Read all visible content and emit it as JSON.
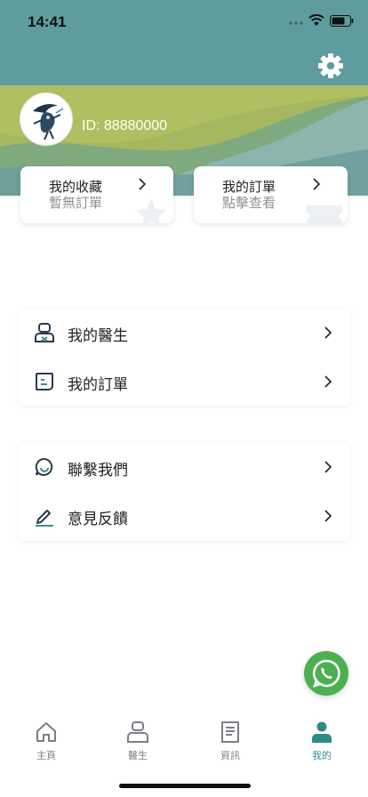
{
  "status_bar": {
    "time": "14:41"
  },
  "profile": {
    "user_id": "ID: 88880000"
  },
  "quick_cards": [
    {
      "title": "我的收藏",
      "subtitle": "暫無訂單"
    },
    {
      "title": "我的訂單",
      "subtitle": "點擊查看"
    }
  ],
  "menu_group_1": [
    {
      "label": "我的醫生",
      "icon": "doctor-icon"
    },
    {
      "label": "我的訂單",
      "icon": "order-icon"
    }
  ],
  "menu_group_2": [
    {
      "label": "聯繫我們",
      "icon": "chat-icon"
    },
    {
      "label": "意見反饋",
      "icon": "pen-icon"
    }
  ],
  "tabbar": {
    "tabs": [
      {
        "label": "主頁",
        "icon": "home-icon"
      },
      {
        "label": "醫生",
        "icon": "doctor-icon"
      },
      {
        "label": "資訊",
        "icon": "news-icon"
      },
      {
        "label": "我的",
        "icon": "user-icon"
      }
    ],
    "active_index": 3
  },
  "colors": {
    "header_teal": "#5f9c9d",
    "header_olive": "#a9bb5e",
    "accent_green": "#3c8f8e",
    "whatsapp_green": "#4caf50"
  }
}
